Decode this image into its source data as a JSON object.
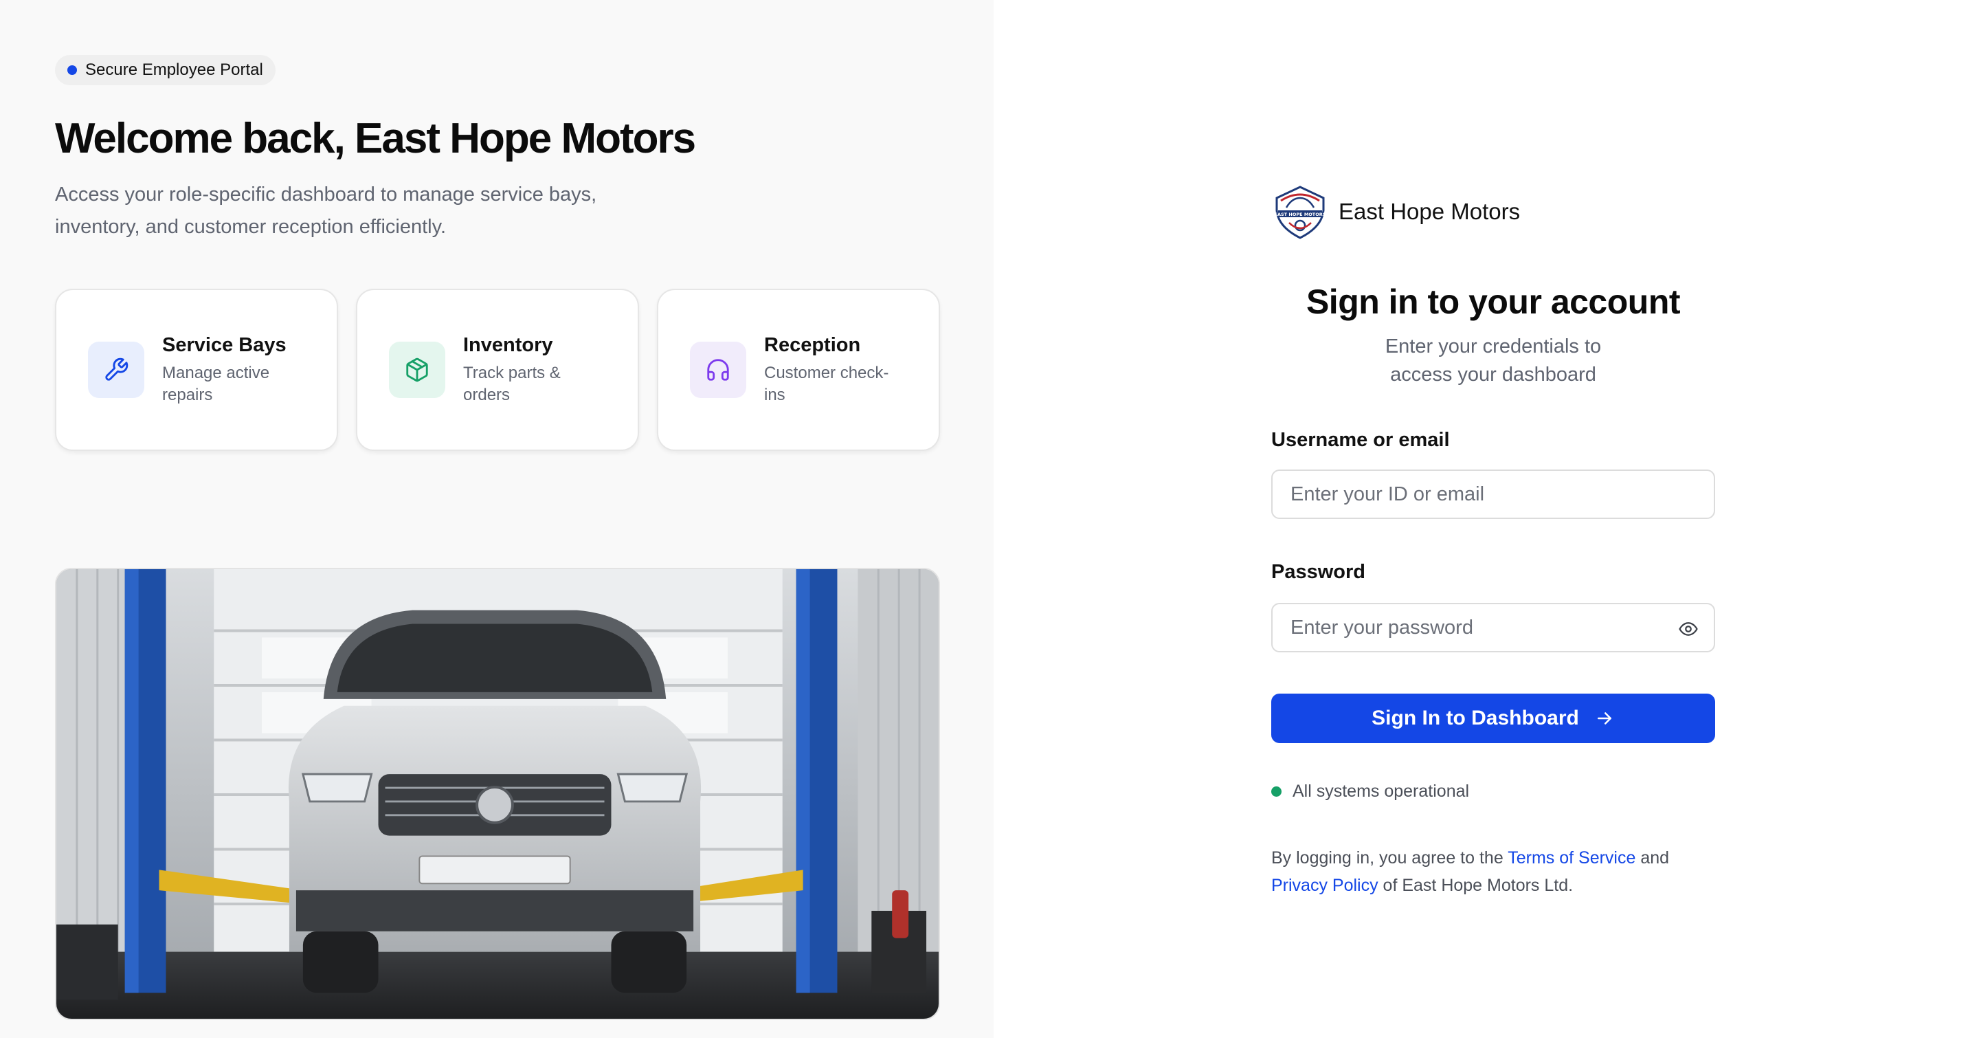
{
  "left": {
    "badge": "Secure Employee Portal",
    "title": "Welcome back, East Hope Motors",
    "subtitle": "Access your role-specific dashboard to manage service bays, inventory, and customer reception efficiently.",
    "cards": [
      {
        "title": "Service Bays",
        "desc": "Manage active repairs",
        "icon": "wrench-icon"
      },
      {
        "title": "Inventory",
        "desc": "Track parts & orders",
        "icon": "box-icon"
      },
      {
        "title": "Reception",
        "desc": "Customer check-ins",
        "icon": "headphones-icon"
      }
    ],
    "photo_icon": "garage-car-lift-photo"
  },
  "right": {
    "brand": {
      "name": "East Hope Motors",
      "logo_text": "EAST HOPE MOTORS"
    },
    "title": "Sign in to your account",
    "subtitle_line1": "Enter your credentials to",
    "subtitle_line2": "access your dashboard",
    "username": {
      "label": "Username or email",
      "placeholder": "Enter your ID or email",
      "value": ""
    },
    "password": {
      "label": "Password",
      "placeholder": "Enter your password",
      "value": ""
    },
    "submit_label": "Sign In to Dashboard",
    "status_text": "All systems operational",
    "legal": {
      "prefix": "By logging in, you agree to the",
      "terms": "Terms of Service",
      "and": "and",
      "privacy": "Privacy Policy",
      "suffix": "of East Hope Motors Ltd."
    }
  },
  "colors": {
    "accent": "#1447e6",
    "status_ok": "#16a067",
    "left_bg": "#f9f9f9"
  }
}
